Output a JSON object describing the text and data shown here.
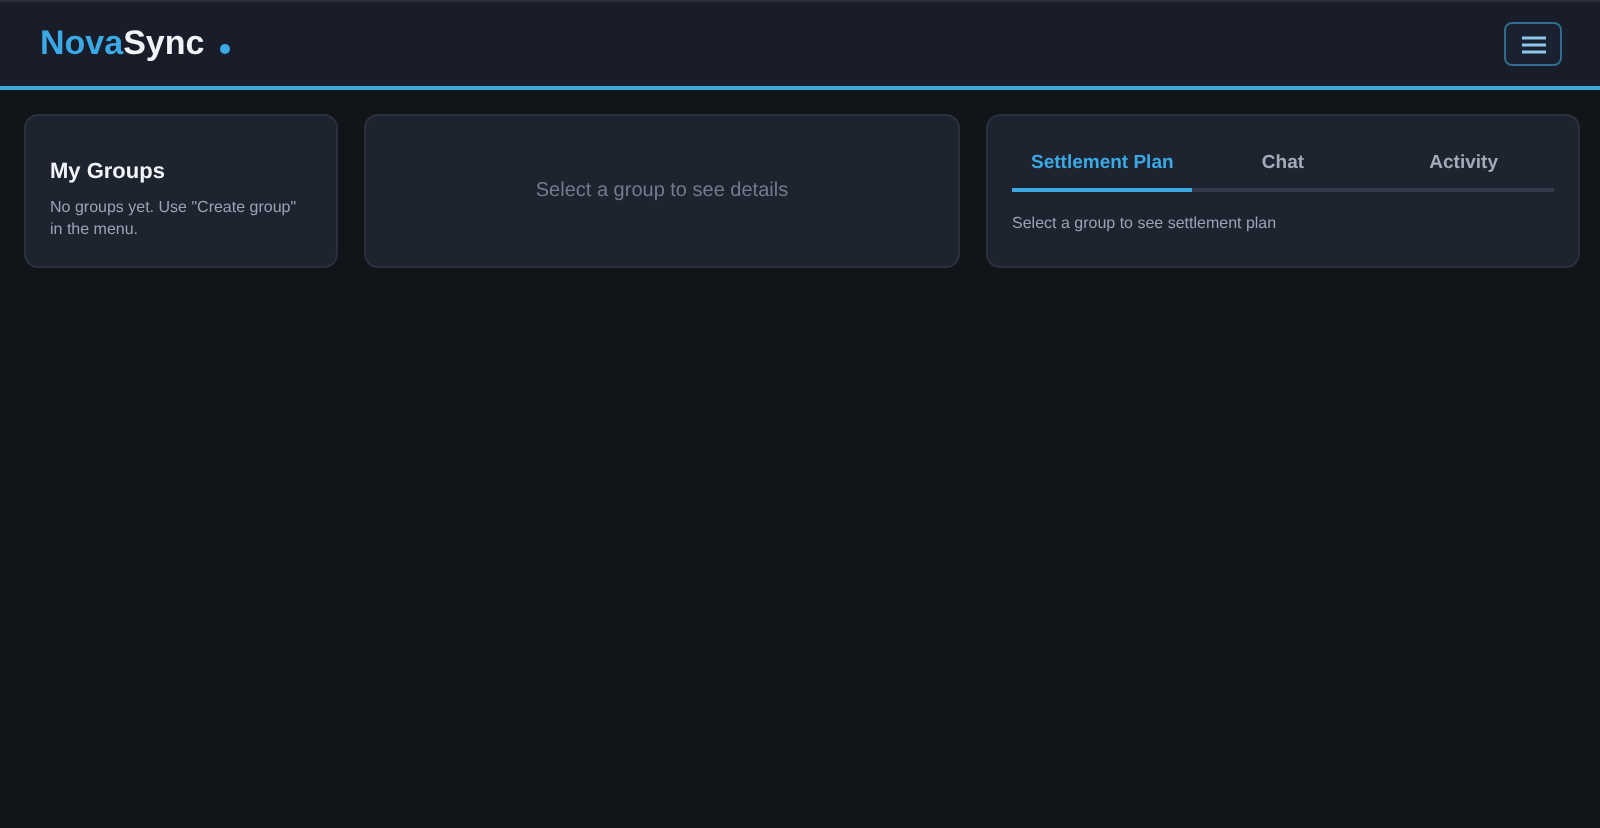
{
  "header": {
    "logo": {
      "accent": "Nova",
      "rest": "Sync"
    }
  },
  "groups_panel": {
    "title": "My Groups",
    "empty_message": "No groups yet. Use \"Create group\" in the menu."
  },
  "details_panel": {
    "placeholder": "Select a group to see details"
  },
  "side_panel": {
    "tabs": [
      {
        "label": "Settlement Plan",
        "selected": true
      },
      {
        "label": "Chat",
        "selected": false
      },
      {
        "label": "Activity",
        "selected": false
      }
    ],
    "message": "Select a group to see settlement plan"
  }
}
